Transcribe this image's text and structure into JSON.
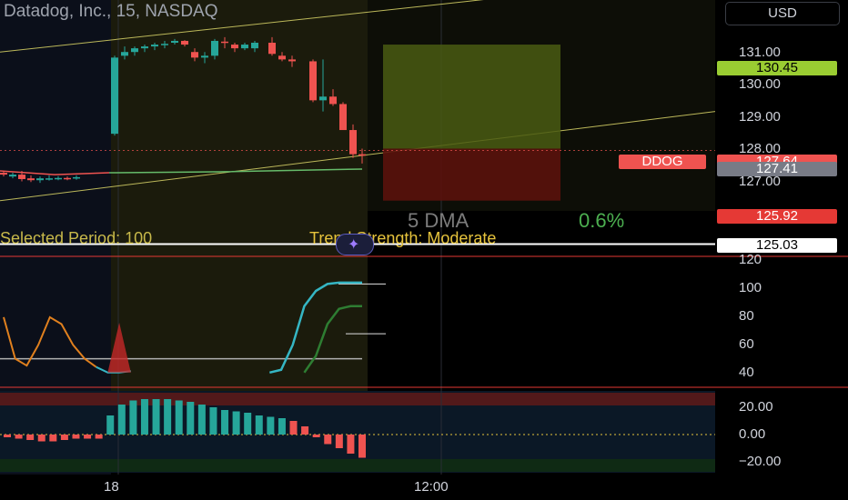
{
  "header": {
    "title": "Datadog, Inc., 15, NASDAQ",
    "currency": "USD"
  },
  "overlay": {
    "dma_label": "5 DMA",
    "dma_value": "0.6%",
    "period_text": "Selected Period: 100",
    "trend_text": "Trend Strength: Moderate"
  },
  "price_axis": [
    "131.00",
    "130.00",
    "129.00",
    "128.00",
    "127.00"
  ],
  "osc1_axis": [
    "120",
    "100",
    "80",
    "60",
    "40"
  ],
  "osc2_axis": [
    "20.00",
    "0.00",
    "−20.00"
  ],
  "time_axis": [
    "18",
    "12:00"
  ],
  "badges": {
    "green_price": "130.45",
    "ticker": "DDOG",
    "ticker_price": "127.64",
    "current_price": "127.41",
    "stop_price": "125.92",
    "line_price": "125.03"
  },
  "colors": {
    "up": "#26a69a",
    "down": "#ef5350",
    "background": "#000000",
    "accent": "#7b5cff"
  },
  "chart_data": [
    {
      "type": "candlestick",
      "title": "Datadog, Inc., 15, NASDAQ",
      "ylim": [
        124.7,
        131.6
      ],
      "candles": [
        {
          "o": 126.95,
          "h": 127.0,
          "l": 126.85,
          "c": 126.9
        },
        {
          "o": 126.85,
          "h": 126.95,
          "l": 126.8,
          "c": 126.9
        },
        {
          "o": 126.9,
          "h": 127.0,
          "l": 126.72,
          "c": 126.78
        },
        {
          "o": 126.8,
          "h": 126.88,
          "l": 126.7,
          "c": 126.75
        },
        {
          "o": 126.75,
          "h": 126.85,
          "l": 126.68,
          "c": 126.8
        },
        {
          "o": 126.8,
          "h": 126.88,
          "l": 126.74,
          "c": 126.8
        },
        {
          "o": 126.8,
          "h": 126.86,
          "l": 126.75,
          "c": 126.81
        },
        {
          "o": 126.81,
          "h": 126.85,
          "l": 126.75,
          "c": 126.8
        },
        {
          "o": 126.8,
          "h": 126.88,
          "l": 126.76,
          "c": 126.83
        },
        {
          "o": 128.0,
          "h": 130.1,
          "l": 127.95,
          "c": 130.05
        },
        {
          "o": 130.1,
          "h": 130.35,
          "l": 130.0,
          "c": 130.2
        },
        {
          "o": 130.2,
          "h": 130.35,
          "l": 130.1,
          "c": 130.3
        },
        {
          "o": 130.3,
          "h": 130.4,
          "l": 130.2,
          "c": 130.35
        },
        {
          "o": 130.35,
          "h": 130.45,
          "l": 130.25,
          "c": 130.4
        },
        {
          "o": 130.4,
          "h": 130.5,
          "l": 130.3,
          "c": 130.42
        },
        {
          "o": 130.45,
          "h": 130.55,
          "l": 130.4,
          "c": 130.5
        },
        {
          "o": 130.5,
          "h": 130.52,
          "l": 130.35,
          "c": 130.4
        },
        {
          "o": 130.2,
          "h": 130.3,
          "l": 129.95,
          "c": 130.05
        },
        {
          "o": 130.05,
          "h": 130.2,
          "l": 129.9,
          "c": 130.1
        },
        {
          "o": 130.1,
          "h": 130.55,
          "l": 130.0,
          "c": 130.5
        },
        {
          "o": 130.48,
          "h": 130.6,
          "l": 130.3,
          "c": 130.45
        },
        {
          "o": 130.4,
          "h": 130.45,
          "l": 130.2,
          "c": 130.3
        },
        {
          "o": 130.3,
          "h": 130.45,
          "l": 130.25,
          "c": 130.4
        },
        {
          "o": 130.3,
          "h": 130.5,
          "l": 130.2,
          "c": 130.45
        },
        {
          "o": 130.45,
          "h": 130.6,
          "l": 130.1,
          "c": 130.15
        },
        {
          "o": 130.1,
          "h": 130.2,
          "l": 129.95,
          "c": 130.0
        },
        {
          "o": 130.0,
          "h": 130.1,
          "l": 129.8,
          "c": 129.95
        },
        {
          "o": 129.95,
          "h": 130.0,
          "l": 128.85,
          "c": 128.9
        },
        {
          "o": 128.9,
          "h": 130.0,
          "l": 128.6,
          "c": 129.0
        },
        {
          "o": 129.0,
          "h": 129.2,
          "l": 128.75,
          "c": 128.8
        },
        {
          "o": 128.8,
          "h": 128.85,
          "l": 128.1,
          "c": 128.1
        },
        {
          "o": 128.1,
          "h": 128.25,
          "l": 127.35,
          "c": 127.45
        },
        {
          "o": 127.45,
          "h": 127.6,
          "l": 127.2,
          "c": 127.41
        }
      ]
    },
    {
      "type": "line",
      "series": [
        {
          "values": [
            80,
            50,
            45,
            60,
            80,
            75,
            60,
            50,
            44,
            40,
            40,
            41,
            42,
            58,
            70,
            76,
            72,
            62,
            55,
            48,
            44,
            42,
            40,
            40,
            42,
            60,
            88,
            99,
            104,
            105,
            105,
            105
          ]
        },
        {
          "values": [
            null,
            null,
            null,
            null,
            null,
            null,
            null,
            null,
            null,
            null,
            null,
            null,
            null,
            null,
            null,
            null,
            null,
            null,
            null,
            null,
            null,
            null,
            null,
            null,
            null,
            null,
            40,
            52,
            75,
            86,
            88,
            88
          ]
        }
      ]
    },
    {
      "type": "bar",
      "values": [
        -2,
        -3,
        -4,
        -5,
        -5,
        -4,
        -3,
        -3,
        -3,
        14,
        22,
        25,
        26,
        26,
        26,
        25,
        24,
        22,
        20,
        18,
        17,
        16,
        14,
        13,
        12,
        10,
        6,
        -2,
        -7,
        -10,
        -14,
        -17
      ]
    }
  ]
}
